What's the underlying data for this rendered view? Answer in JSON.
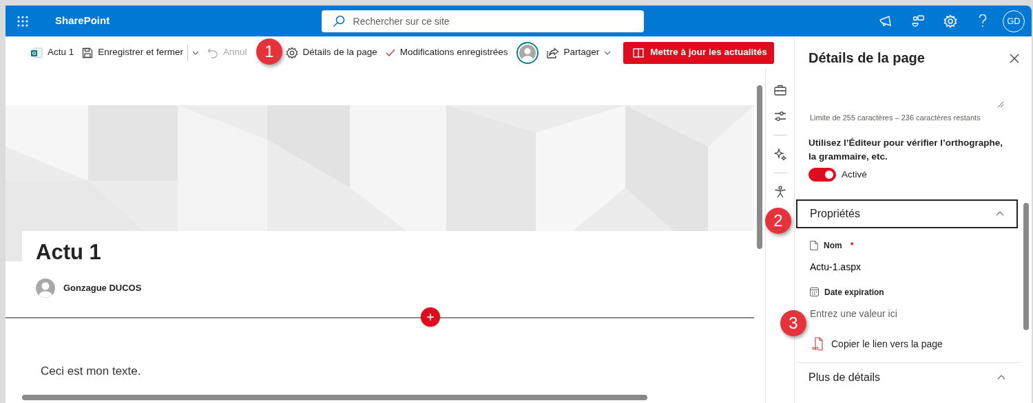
{
  "suite_bar": {
    "app_name": "SharePoint",
    "search": {
      "placeholder": "Rechercher sur ce site"
    },
    "account_initials": "GD"
  },
  "command_bar": {
    "items": [
      {
        "kind": "page",
        "label": "Actu 1",
        "disabled": false
      },
      {
        "kind": "save",
        "label": "Enregistrer et fermer",
        "disabled": false
      },
      {
        "kind": "undo",
        "label": "Annul",
        "disabled": true
      },
      {
        "kind": "details",
        "label": "Détails de la page",
        "disabled": false
      },
      {
        "kind": "status",
        "label": "Modifications enregistrées",
        "disabled": false
      },
      {
        "kind": "avatar"
      },
      {
        "kind": "share",
        "label": "Partager",
        "disabled": false
      }
    ],
    "primary_button": "Mettre à jour les actualités"
  },
  "page": {
    "title": "Actu 1",
    "author": "Gonzague DUCOS",
    "text": "Ceci est mon texte."
  },
  "details_panel": {
    "title": "Détails de la page",
    "char_hint": "Limite de 255 caractères – 236 caractères restants",
    "editor_label": "Utilisez l’Éditeur pour vérifier l’orthographe, la grammaire, etc.",
    "editor_toggle": {
      "on": true,
      "label": "Activé"
    },
    "sections": [
      {
        "title": "Propriétés",
        "expanded": true,
        "focused": true,
        "fields": [
          {
            "kind": "text",
            "label": "Nom",
            "required_mark": "*",
            "value": "Actu-1.aspx"
          },
          {
            "kind": "date",
            "label": "Date expiration",
            "placeholder": "Entrez une valeur ici"
          }
        ],
        "link": "Copier le lien vers la page"
      },
      {
        "title": "Plus de détails",
        "expanded": true,
        "focused": false
      }
    ]
  },
  "callouts": [
    {
      "number": "1"
    },
    {
      "number": "2"
    },
    {
      "number": "3"
    }
  ]
}
